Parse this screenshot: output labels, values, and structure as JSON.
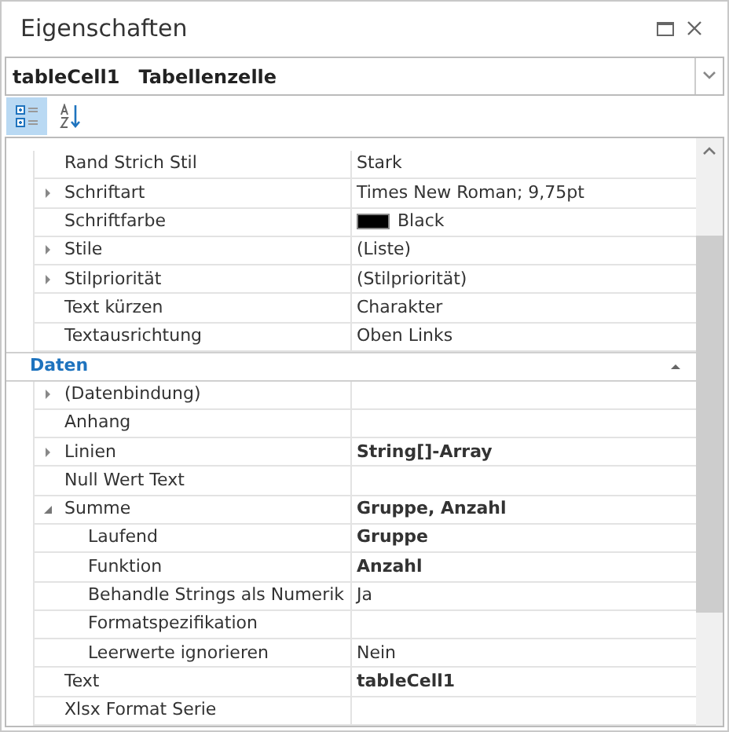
{
  "window": {
    "title": "Eigenschaften"
  },
  "object_selector": {
    "name": "tableCell1",
    "type": "Tabellenzelle"
  },
  "toolbar": [
    {
      "kind": "categorized",
      "selected": true
    },
    {
      "kind": "alphabetical",
      "selected": false
    }
  ],
  "sections": [
    {
      "rows": [
        {
          "name": "Rand Strich Stil",
          "value": "Stark",
          "bold": false,
          "expandable": false
        },
        {
          "name": "Schriftart",
          "value": "Times New Roman; 9,75pt",
          "bold": false,
          "expandable": true,
          "expanded": false
        },
        {
          "name": "Schriftfarbe",
          "value": "Black",
          "bold": false,
          "expandable": false,
          "color": "#000000"
        },
        {
          "name": "Stile",
          "value": "(Liste)",
          "bold": false,
          "expandable": true,
          "expanded": false
        },
        {
          "name": "Stilpriorität",
          "value": "(Stilpriorität)",
          "bold": false,
          "expandable": true,
          "expanded": false
        },
        {
          "name": "Text kürzen",
          "value": "Charakter",
          "bold": false,
          "expandable": false
        },
        {
          "name": "Textausrichtung",
          "value": "Oben Links",
          "bold": false,
          "expandable": false
        }
      ]
    },
    {
      "title": "Daten",
      "expanded": true,
      "rows": [
        {
          "name": "(Datenbindung)",
          "expandable": true,
          "expanded": false
        },
        {
          "name": "Anhang",
          "expandable": false
        },
        {
          "name": "Linien",
          "value": "String[]-Array",
          "bold": true,
          "expandable": true,
          "expanded": false
        },
        {
          "name": "Null Wert Text",
          "expandable": false
        },
        {
          "name": "Summe",
          "value": "Gruppe, Anzahl",
          "bold": true,
          "expandable": true,
          "expanded": true,
          "children": [
            {
              "name": "Laufend",
              "value": "Gruppe",
              "bold": true,
              "expandable": false
            },
            {
              "name": "Funktion",
              "value": "Anzahl",
              "bold": true,
              "expandable": false
            },
            {
              "name": "Behandle Strings als Numerik",
              "value": "Ja",
              "bold": false,
              "expandable": false
            },
            {
              "name": "Formatspezifikation",
              "expandable": false
            },
            {
              "name": "Leerwerte ignorieren",
              "value": "Nein",
              "bold": false,
              "expandable": false
            }
          ]
        },
        {
          "name": "Text",
          "value": "tableCell1",
          "bold": true,
          "expandable": false
        },
        {
          "name": "Xlsx Format Serie",
          "expandable": false
        }
      ]
    }
  ]
}
